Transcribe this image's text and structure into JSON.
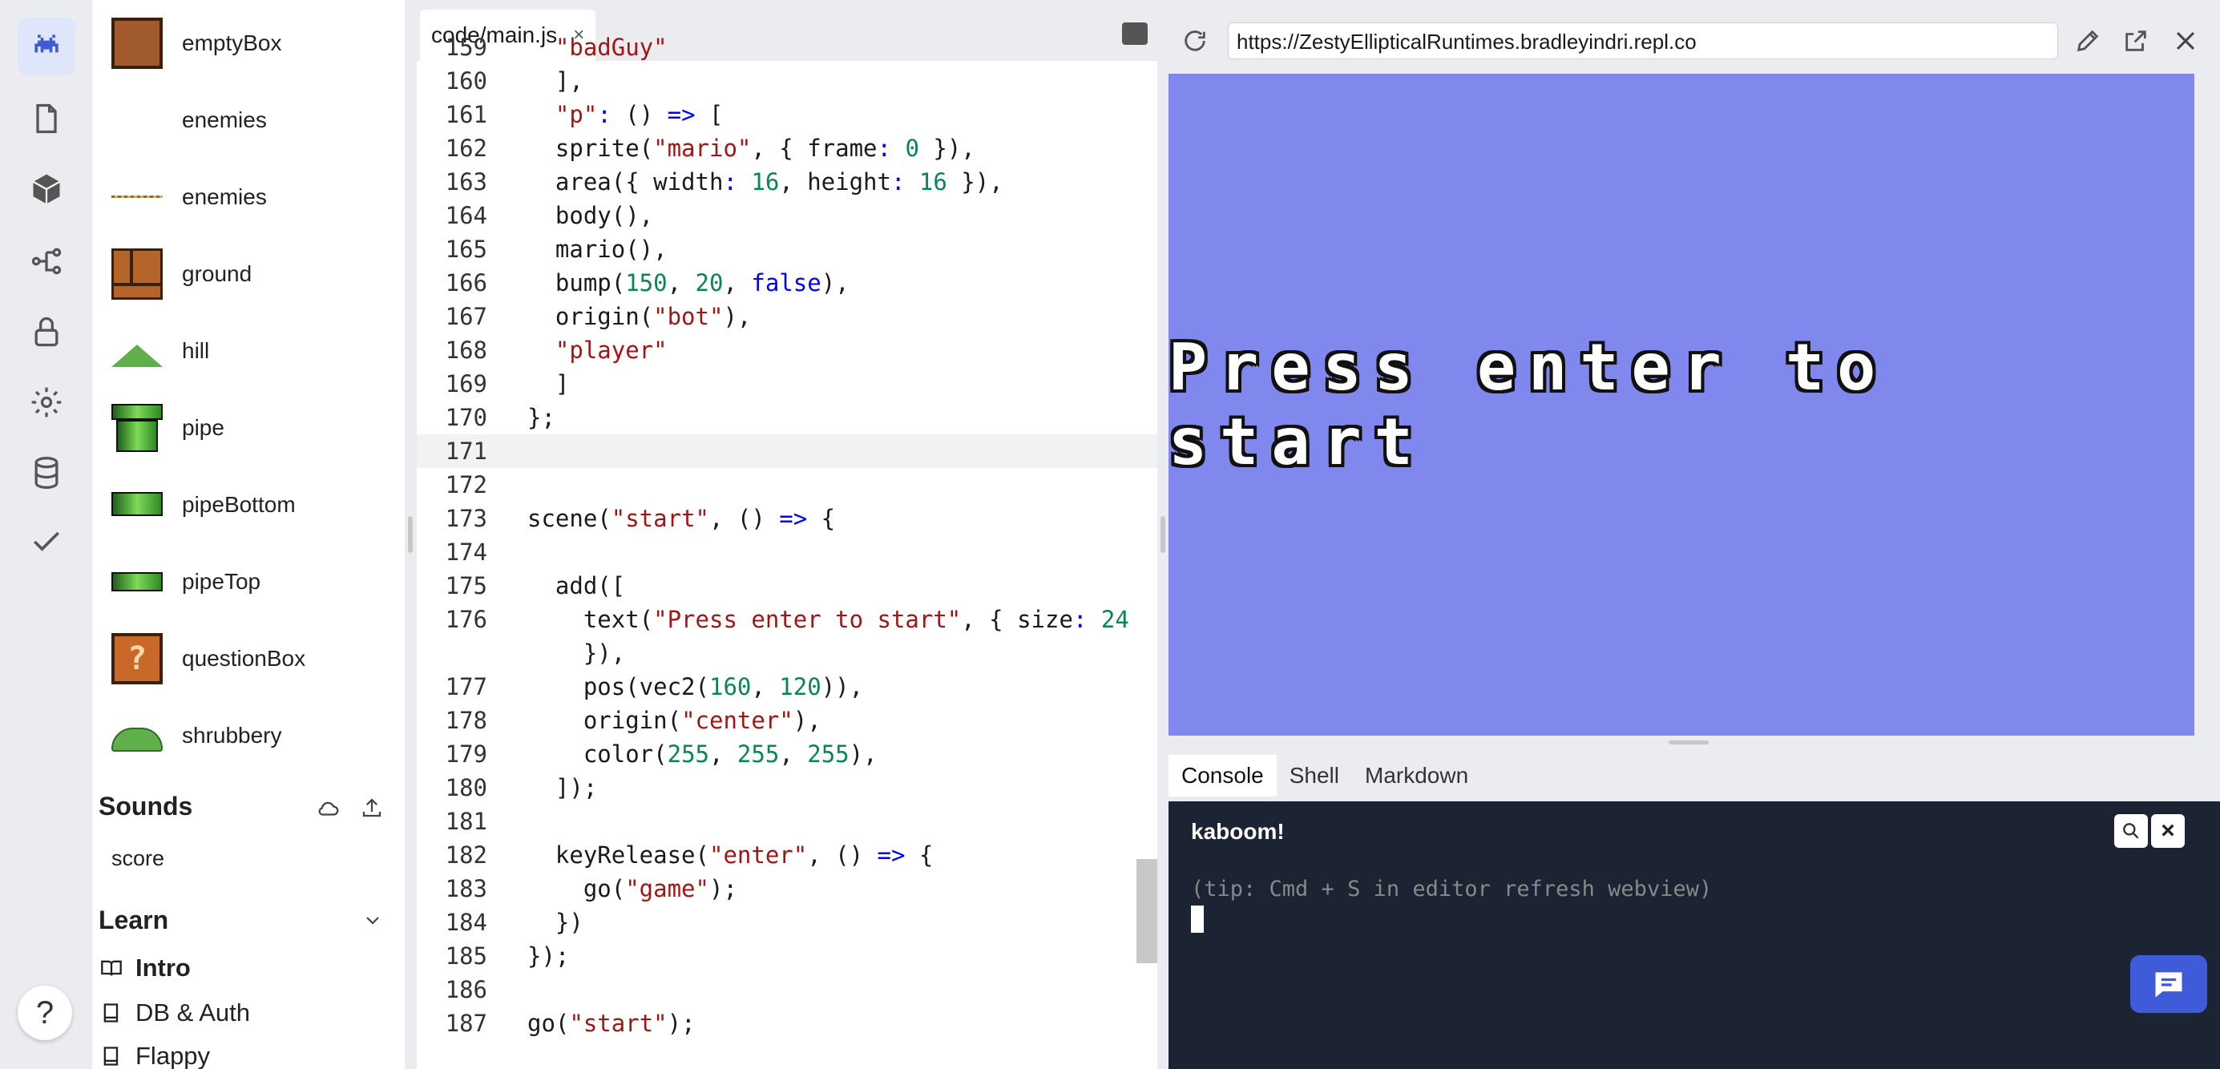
{
  "sidebar": {
    "assets": [
      {
        "label": "emptyBox"
      },
      {
        "label": "enemies"
      },
      {
        "label": "enemies"
      },
      {
        "label": "ground"
      },
      {
        "label": "hill"
      },
      {
        "label": "pipe"
      },
      {
        "label": "pipeBottom"
      },
      {
        "label": "pipeTop"
      },
      {
        "label": "questionBox"
      },
      {
        "label": "shrubbery"
      }
    ],
    "sounds_title": "Sounds",
    "sounds": [
      {
        "label": "score"
      }
    ],
    "learn_title": "Learn",
    "learn_items": [
      {
        "label": "Intro"
      },
      {
        "label": "DB & Auth"
      },
      {
        "label": "Flappy"
      }
    ],
    "help_label": "?"
  },
  "editor": {
    "tab_label": "code/main.js",
    "tab_close": "×"
  },
  "webview": {
    "url": "https://ZestyEllipticalRuntimes.bradleyindri.repl.co",
    "game_text": "Press enter to start"
  },
  "console": {
    "tabs": [
      {
        "label": "Console"
      },
      {
        "label": "Shell"
      },
      {
        "label": "Markdown"
      }
    ],
    "title": "kaboom!",
    "tip": "(tip: Cmd + S in editor refresh webview)",
    "close": "×"
  },
  "code_lines": [
    {
      "n": "159",
      "t": "  \"badGuy\""
    },
    {
      "n": "160",
      "t": "],"
    },
    {
      "n": "161",
      "t": "\"p\": () => ["
    },
    {
      "n": "162",
      "t": "  sprite(\"mario\", { frame: 0 }),"
    },
    {
      "n": "163",
      "t": "  area({ width: 16, height: 16 }),"
    },
    {
      "n": "164",
      "t": "  body(),"
    },
    {
      "n": "165",
      "t": "  mario(),"
    },
    {
      "n": "166",
      "t": "  bump(150, 20, false),"
    },
    {
      "n": "167",
      "t": "  origin(\"bot\"),"
    },
    {
      "n": "168",
      "t": "  \"player\""
    },
    {
      "n": "169",
      "t": "]"
    },
    {
      "n": "170",
      "t": "};"
    },
    {
      "n": "171",
      "t": ""
    },
    {
      "n": "172",
      "t": ""
    },
    {
      "n": "173",
      "t": "scene(\"start\", () => {"
    },
    {
      "n": "174",
      "t": ""
    },
    {
      "n": "175",
      "t": "  add(["
    },
    {
      "n": "176",
      "t": "    text(\"Press enter to start\", { size: 24"
    },
    {
      "n": "",
      "t": "    }),"
    },
    {
      "n": "177",
      "t": "    pos(vec2(160, 120)),"
    },
    {
      "n": "178",
      "t": "    origin(\"center\"),"
    },
    {
      "n": "179",
      "t": "    color(255, 255, 255),"
    },
    {
      "n": "180",
      "t": "  ]);"
    },
    {
      "n": "181",
      "t": ""
    },
    {
      "n": "182",
      "t": "  keyRelease(\"enter\", () => {"
    },
    {
      "n": "183",
      "t": "    go(\"game\");"
    },
    {
      "n": "184",
      "t": "  })"
    },
    {
      "n": "185",
      "t": "});"
    },
    {
      "n": "186",
      "t": ""
    },
    {
      "n": "187",
      "t": "go(\"start\");"
    }
  ]
}
